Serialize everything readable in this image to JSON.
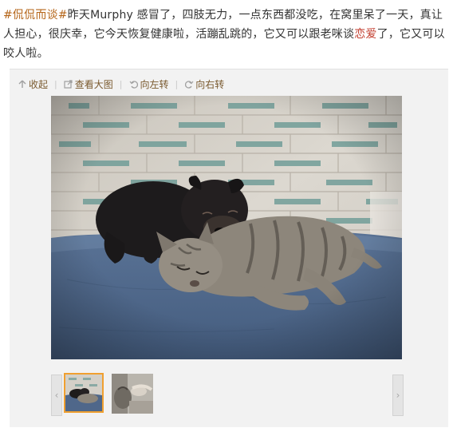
{
  "post": {
    "topic": "#侃侃而谈#",
    "text_before": "昨天Murphy 感冒了，四肢无力，一点东西都没吃，在窝里呆了一天，真让人担心，很庆幸，它今天恢复健康啦，活蹦乱跳的，它又可以跟老咪谈",
    "highlight": "恋爱",
    "text_after": "了，它又可以咬人啦。"
  },
  "toolbar": {
    "collapse_label": "收起",
    "view_large_label": "查看大图",
    "rotate_left_label": "向左转",
    "rotate_right_label": "向右转",
    "separator": "|"
  },
  "icons": {
    "collapse": "up-arrow-icon",
    "view_large": "external-link-icon",
    "rotate_left": "rotate-left-icon",
    "rotate_right": "rotate-right-icon",
    "prev": "chevron-left-icon",
    "next": "chevron-right-icon"
  },
  "strip": {
    "prev_glyph": "‹",
    "next_glyph": "›"
  },
  "colors": {
    "topic": "#b5661a",
    "highlight": "#c23a2b",
    "toolbar_text": "#7a5a2f",
    "active_thumb_border": "#f0a030"
  }
}
